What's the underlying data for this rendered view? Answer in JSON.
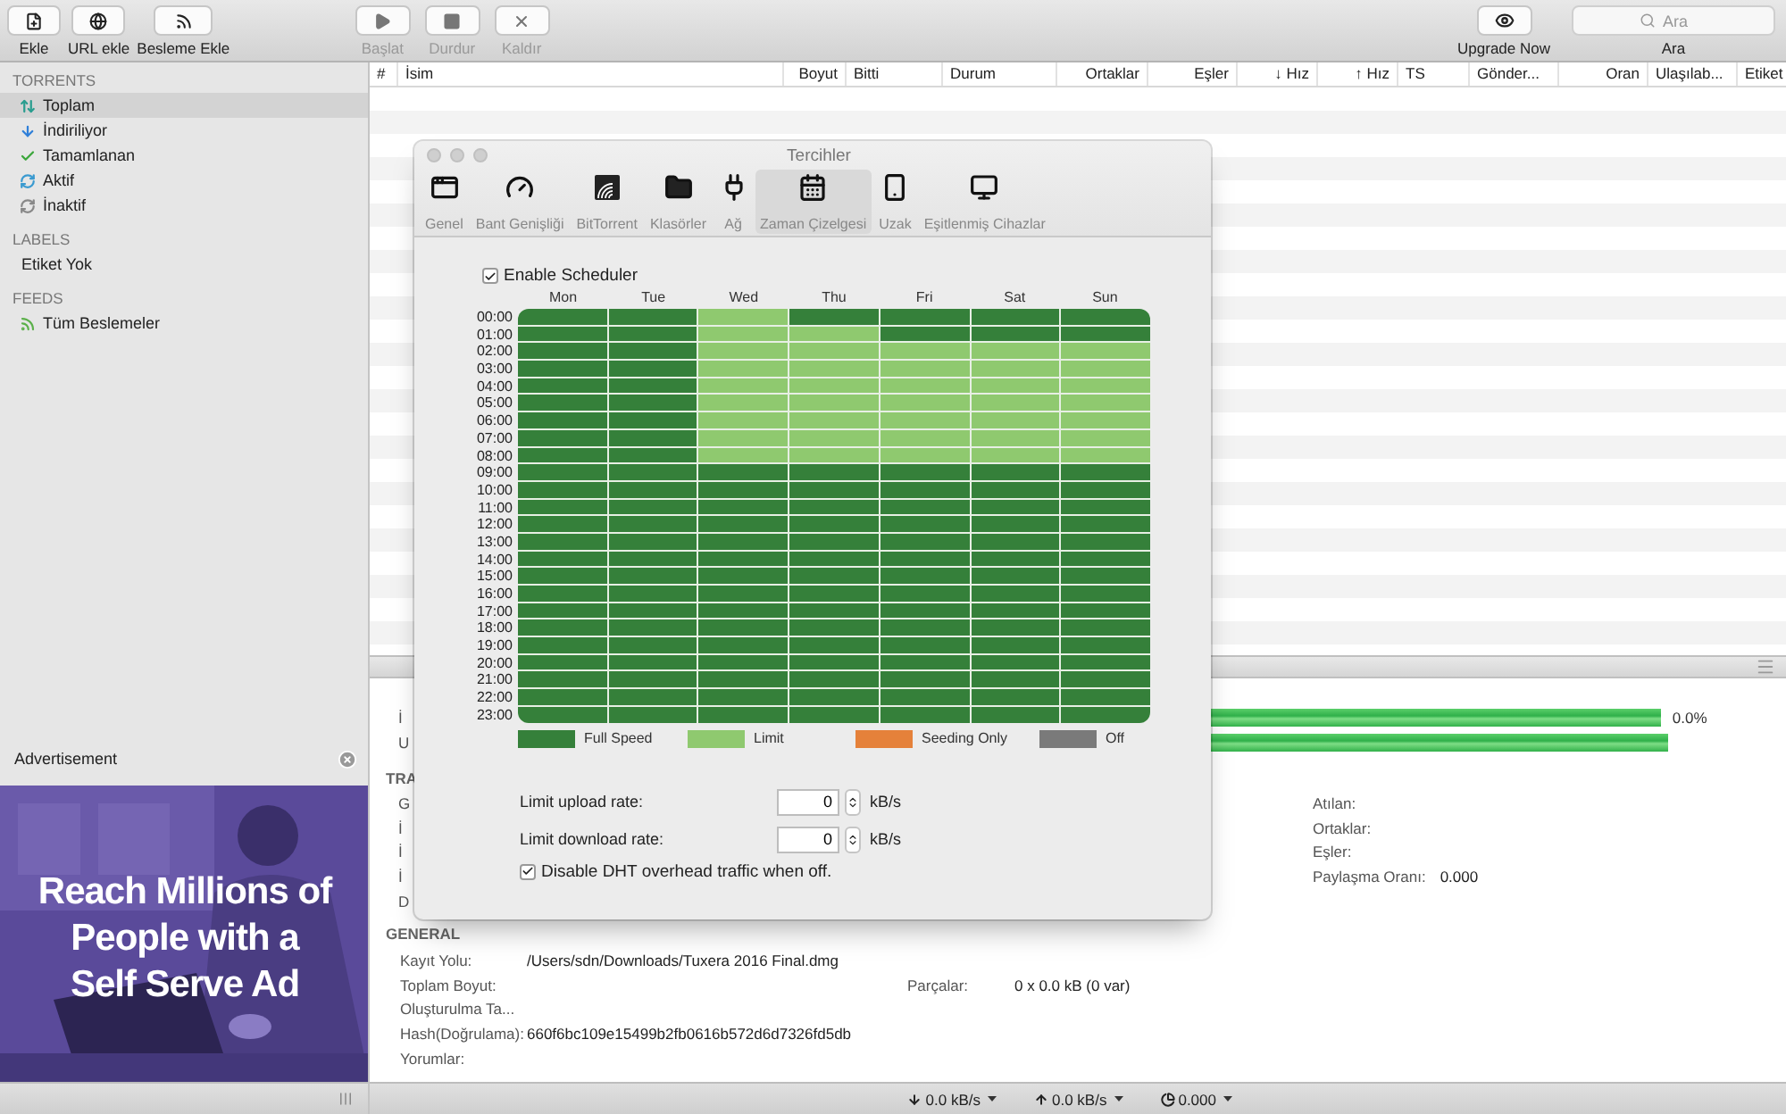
{
  "toolbar": {
    "left": [
      {
        "label": "Ekle",
        "disabled": false
      },
      {
        "label": "URL ekle",
        "disabled": false
      },
      {
        "label": "Besleme Ekle",
        "disabled": false
      }
    ],
    "center": [
      {
        "label": "Başlat",
        "disabled": true
      },
      {
        "label": "Durdur",
        "disabled": true
      },
      {
        "label": "Kaldır",
        "disabled": true
      }
    ],
    "upgrade": {
      "label": "Upgrade Now"
    },
    "search": {
      "placeholder": "Ara",
      "label": "Ara"
    }
  },
  "sidebar": {
    "sections": [
      {
        "title": "TORRENTS",
        "items": [
          {
            "label": "Toplam",
            "selected": true
          },
          {
            "label": "İndiriliyor",
            "selected": false
          },
          {
            "label": "Tamamlanan",
            "selected": false
          },
          {
            "label": "Aktif",
            "selected": false
          },
          {
            "label": "İnaktif",
            "selected": false
          }
        ]
      },
      {
        "title": "LABELS",
        "items": [
          {
            "label": "Etiket Yok",
            "selected": false
          }
        ]
      },
      {
        "title": "FEEDS",
        "items": [
          {
            "label": "Tüm Beslemeler",
            "selected": false
          }
        ]
      }
    ],
    "ad": {
      "title": "Advertisement",
      "headline": "Reach Millions of People with a Self Serve Ad"
    }
  },
  "table": {
    "columns": [
      "#",
      "İsim",
      "Boyut",
      "Bitti",
      "Durum",
      "Ortaklar",
      "Eşler",
      "↓ Hız",
      "↑ Hız",
      "TS",
      "Gönder...",
      "Oran",
      "Ulaşılab...",
      "Etiket"
    ]
  },
  "details": {
    "progress": [
      {
        "label": "İ",
        "level": 1,
        "reading": "0.0%"
      },
      {
        "label": "U",
        "level": 1
      }
    ],
    "transfer": {
      "title": "TRA",
      "left": [
        "G",
        "İ",
        "İ",
        "İ",
        "D"
      ],
      "right": [
        {
          "label": "Atılan:"
        },
        {
          "label": "Ortaklar:"
        },
        {
          "label": "Eşler:"
        },
        {
          "label": "Paylaşma Oranı:",
          "value": "0.000"
        }
      ]
    },
    "general": {
      "title": "GENERAL",
      "rows": [
        {
          "label": "Kayıt Yolu:",
          "value": "/Users/sdn/Downloads/Tuxera 2016 Final.dmg"
        },
        {
          "label": "Toplam Boyut:",
          "side_label": "Parçalar:",
          "side_value": "0 x 0.0 kB (0 var)"
        },
        {
          "label": "Oluşturulma Ta..."
        },
        {
          "label": "Hash(Doğrulama):",
          "value": "660f6bc109e15499b2fb0616b572d6d7326fd5db"
        },
        {
          "label": "Yorumlar:"
        }
      ]
    }
  },
  "status_bar": [
    {
      "value": "0.0 kB/s"
    },
    {
      "value": "0.0 kB/s"
    },
    {
      "value": "0.000"
    }
  ],
  "dialog": {
    "title": "Tercihler",
    "tabs": [
      {
        "label": "Genel",
        "selected": false
      },
      {
        "label": "Bant Genişliği",
        "selected": false
      },
      {
        "label": "BitTorrent",
        "selected": false
      },
      {
        "label": "Klasörler",
        "selected": false
      },
      {
        "label": "Ağ",
        "selected": false
      },
      {
        "label": "Zaman Çizelgesi",
        "selected": true
      },
      {
        "label": "Uzak",
        "selected": false
      },
      {
        "label": "Eşitlenmiş Cihazlar",
        "selected": false
      }
    ],
    "enable_scheduler": {
      "label": "Enable Scheduler",
      "checked": true
    },
    "schedule": {
      "days": [
        "Mon",
        "Tue",
        "Wed",
        "Thu",
        "Fri",
        "Sat",
        "Sun"
      ],
      "rows": [
        {
          "time": "00:00",
          "cells": [
            {
              "color": "#35803a"
            },
            {
              "color": "#35803a"
            },
            {
              "color": "#8fc96f"
            },
            {
              "color": "#35803a"
            },
            {
              "color": "#35803a"
            },
            {
              "color": "#35803a"
            },
            {
              "color": "#35803a"
            }
          ]
        },
        {
          "time": "01:00",
          "cells": [
            {
              "color": "#35803a"
            },
            {
              "color": "#35803a"
            },
            {
              "color": "#8fc96f"
            },
            {
              "color": "#8fc96f"
            },
            {
              "color": "#35803a"
            },
            {
              "color": "#35803a"
            },
            {
              "color": "#35803a"
            }
          ]
        },
        {
          "time": "02:00",
          "cells": [
            {
              "color": "#35803a"
            },
            {
              "color": "#35803a"
            },
            {
              "color": "#8fc96f"
            },
            {
              "color": "#8fc96f"
            },
            {
              "color": "#8fc96f"
            },
            {
              "color": "#8fc96f"
            },
            {
              "color": "#8fc96f"
            }
          ]
        },
        {
          "time": "03:00",
          "cells": [
            {
              "color": "#35803a"
            },
            {
              "color": "#35803a"
            },
            {
              "color": "#8fc96f"
            },
            {
              "color": "#8fc96f"
            },
            {
              "color": "#8fc96f"
            },
            {
              "color": "#8fc96f"
            },
            {
              "color": "#8fc96f"
            }
          ]
        },
        {
          "time": "04:00",
          "cells": [
            {
              "color": "#35803a"
            },
            {
              "color": "#35803a"
            },
            {
              "color": "#8fc96f"
            },
            {
              "color": "#8fc96f"
            },
            {
              "color": "#8fc96f"
            },
            {
              "color": "#8fc96f"
            },
            {
              "color": "#8fc96f"
            }
          ]
        },
        {
          "time": "05:00",
          "cells": [
            {
              "color": "#35803a"
            },
            {
              "color": "#35803a"
            },
            {
              "color": "#8fc96f"
            },
            {
              "color": "#8fc96f"
            },
            {
              "color": "#8fc96f"
            },
            {
              "color": "#8fc96f"
            },
            {
              "color": "#8fc96f"
            }
          ]
        },
        {
          "time": "06:00",
          "cells": [
            {
              "color": "#35803a"
            },
            {
              "color": "#35803a"
            },
            {
              "color": "#8fc96f"
            },
            {
              "color": "#8fc96f"
            },
            {
              "color": "#8fc96f"
            },
            {
              "color": "#8fc96f"
            },
            {
              "color": "#8fc96f"
            }
          ]
        },
        {
          "time": "07:00",
          "cells": [
            {
              "color": "#35803a"
            },
            {
              "color": "#35803a"
            },
            {
              "color": "#8fc96f"
            },
            {
              "color": "#8fc96f"
            },
            {
              "color": "#8fc96f"
            },
            {
              "color": "#8fc96f"
            },
            {
              "color": "#8fc96f"
            }
          ]
        },
        {
          "time": "08:00",
          "cells": [
            {
              "color": "#35803a"
            },
            {
              "color": "#35803a"
            },
            {
              "color": "#8fc96f"
            },
            {
              "color": "#8fc96f"
            },
            {
              "color": "#8fc96f"
            },
            {
              "color": "#8fc96f"
            },
            {
              "color": "#8fc96f"
            }
          ]
        },
        {
          "time": "09:00",
          "cells": [
            {
              "color": "#35803a"
            },
            {
              "color": "#35803a"
            },
            {
              "color": "#35803a"
            },
            {
              "color": "#35803a"
            },
            {
              "color": "#35803a"
            },
            {
              "color": "#35803a"
            },
            {
              "color": "#35803a"
            }
          ]
        },
        {
          "time": "10:00",
          "cells": [
            {
              "color": "#35803a"
            },
            {
              "color": "#35803a"
            },
            {
              "color": "#35803a"
            },
            {
              "color": "#35803a"
            },
            {
              "color": "#35803a"
            },
            {
              "color": "#35803a"
            },
            {
              "color": "#35803a"
            }
          ]
        },
        {
          "time": "11:00",
          "cells": [
            {
              "color": "#35803a"
            },
            {
              "color": "#35803a"
            },
            {
              "color": "#35803a"
            },
            {
              "color": "#35803a"
            },
            {
              "color": "#35803a"
            },
            {
              "color": "#35803a"
            },
            {
              "color": "#35803a"
            }
          ]
        },
        {
          "time": "12:00",
          "cells": [
            {
              "color": "#35803a"
            },
            {
              "color": "#35803a"
            },
            {
              "color": "#35803a"
            },
            {
              "color": "#35803a"
            },
            {
              "color": "#35803a"
            },
            {
              "color": "#35803a"
            },
            {
              "color": "#35803a"
            }
          ]
        },
        {
          "time": "13:00",
          "cells": [
            {
              "color": "#35803a"
            },
            {
              "color": "#35803a"
            },
            {
              "color": "#35803a"
            },
            {
              "color": "#35803a"
            },
            {
              "color": "#35803a"
            },
            {
              "color": "#35803a"
            },
            {
              "color": "#35803a"
            }
          ]
        },
        {
          "time": "14:00",
          "cells": [
            {
              "color": "#35803a"
            },
            {
              "color": "#35803a"
            },
            {
              "color": "#35803a"
            },
            {
              "color": "#35803a"
            },
            {
              "color": "#35803a"
            },
            {
              "color": "#35803a"
            },
            {
              "color": "#35803a"
            }
          ]
        },
        {
          "time": "15:00",
          "cells": [
            {
              "color": "#35803a"
            },
            {
              "color": "#35803a"
            },
            {
              "color": "#35803a"
            },
            {
              "color": "#35803a"
            },
            {
              "color": "#35803a"
            },
            {
              "color": "#35803a"
            },
            {
              "color": "#35803a"
            }
          ]
        },
        {
          "time": "16:00",
          "cells": [
            {
              "color": "#35803a"
            },
            {
              "color": "#35803a"
            },
            {
              "color": "#35803a"
            },
            {
              "color": "#35803a"
            },
            {
              "color": "#35803a"
            },
            {
              "color": "#35803a"
            },
            {
              "color": "#35803a"
            }
          ]
        },
        {
          "time": "17:00",
          "cells": [
            {
              "color": "#35803a"
            },
            {
              "color": "#35803a"
            },
            {
              "color": "#35803a"
            },
            {
              "color": "#35803a"
            },
            {
              "color": "#35803a"
            },
            {
              "color": "#35803a"
            },
            {
              "color": "#35803a"
            }
          ]
        },
        {
          "time": "18:00",
          "cells": [
            {
              "color": "#35803a"
            },
            {
              "color": "#35803a"
            },
            {
              "color": "#35803a"
            },
            {
              "color": "#35803a"
            },
            {
              "color": "#35803a"
            },
            {
              "color": "#35803a"
            },
            {
              "color": "#35803a"
            }
          ]
        },
        {
          "time": "19:00",
          "cells": [
            {
              "color": "#35803a"
            },
            {
              "color": "#35803a"
            },
            {
              "color": "#35803a"
            },
            {
              "color": "#35803a"
            },
            {
              "color": "#35803a"
            },
            {
              "color": "#35803a"
            },
            {
              "color": "#35803a"
            }
          ]
        },
        {
          "time": "20:00",
          "cells": [
            {
              "color": "#35803a"
            },
            {
              "color": "#35803a"
            },
            {
              "color": "#35803a"
            },
            {
              "color": "#35803a"
            },
            {
              "color": "#35803a"
            },
            {
              "color": "#35803a"
            },
            {
              "color": "#35803a"
            }
          ]
        },
        {
          "time": "21:00",
          "cells": [
            {
              "color": "#35803a"
            },
            {
              "color": "#35803a"
            },
            {
              "color": "#35803a"
            },
            {
              "color": "#35803a"
            },
            {
              "color": "#35803a"
            },
            {
              "color": "#35803a"
            },
            {
              "color": "#35803a"
            }
          ]
        },
        {
          "time": "22:00",
          "cells": [
            {
              "color": "#35803a"
            },
            {
              "color": "#35803a"
            },
            {
              "color": "#35803a"
            },
            {
              "color": "#35803a"
            },
            {
              "color": "#35803a"
            },
            {
              "color": "#35803a"
            },
            {
              "color": "#35803a"
            }
          ]
        },
        {
          "time": "23:00",
          "cells": [
            {
              "color": "#35803a"
            },
            {
              "color": "#35803a"
            },
            {
              "color": "#35803a"
            },
            {
              "color": "#35803a"
            },
            {
              "color": "#35803a"
            },
            {
              "color": "#35803a"
            },
            {
              "color": "#35803a"
            }
          ]
        }
      ]
    },
    "legend": [
      {
        "label": "Full Speed",
        "color": "#35803a"
      },
      {
        "label": "Limit",
        "color": "#8fc96f"
      },
      {
        "label": "Seeding Only",
        "color": "#e5813a"
      },
      {
        "label": "Off",
        "color": "#7a7a7a"
      }
    ],
    "rates": [
      {
        "label": "Limit upload rate:",
        "value": "0",
        "unit": "kB/s"
      },
      {
        "label": "Limit download rate:",
        "value": "0",
        "unit": "kB/s"
      }
    ],
    "dht": {
      "label": "Disable DHT overhead traffic when off.",
      "checked": true
    }
  }
}
